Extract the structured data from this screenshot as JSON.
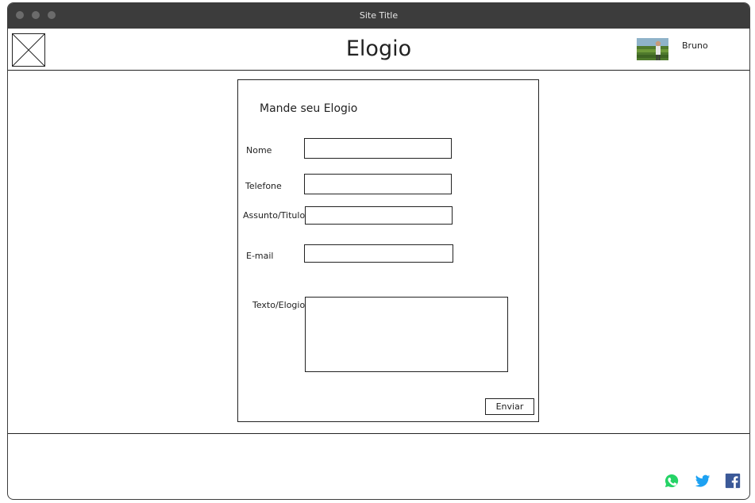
{
  "window": {
    "title": "Site Title"
  },
  "header": {
    "title": "Elogio",
    "user": {
      "name": "Bruno"
    }
  },
  "form": {
    "heading": "Mande seu Elogio",
    "fields": {
      "nome": {
        "label": "Nome",
        "value": ""
      },
      "telefone": {
        "label": "Telefone",
        "value": ""
      },
      "assunto": {
        "label": "Assunto/Titulo",
        "value": ""
      },
      "email": {
        "label": "E-mail",
        "value": ""
      },
      "texto": {
        "label": "Texto/Elogio",
        "value": ""
      }
    },
    "submit_label": "Enviar"
  },
  "footer": {
    "social_icons": [
      "whatsapp-icon",
      "twitter-icon",
      "facebook-icon"
    ],
    "colors": {
      "whatsapp": "#25D366",
      "twitter": "#1DA1F2",
      "facebook": "#3B5998"
    }
  }
}
